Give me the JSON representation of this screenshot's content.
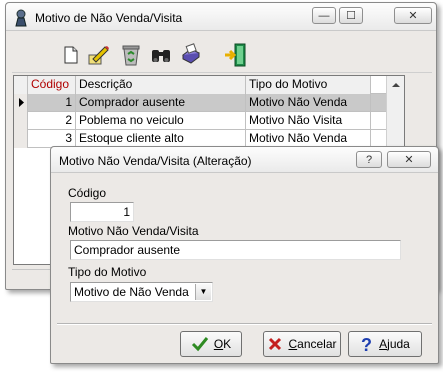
{
  "main_window": {
    "title": "Motivo de Não Venda/Visita",
    "caption_buttons": {
      "minimize": "—",
      "maximize": "☐",
      "close": "✕"
    },
    "toolbar": [
      {
        "name": "new-document-icon",
        "glyph": "🗋"
      },
      {
        "name": "edit-pencil-icon",
        "glyph": "✎"
      },
      {
        "name": "recycle-bin-icon",
        "glyph": "♻"
      },
      {
        "name": "binoculars-icon",
        "glyph": "🔭"
      },
      {
        "name": "print-icon",
        "glyph": "⎙"
      },
      {
        "name": "exit-door-icon",
        "glyph": "⇥"
      }
    ],
    "grid": {
      "columns": [
        "Código",
        "Descrição",
        "Tipo do Motivo"
      ],
      "rows": [
        {
          "codigo": "1",
          "descricao": "Comprador ausente",
          "tipo": "Motivo Não Venda",
          "selected": true
        },
        {
          "codigo": "2",
          "descricao": "Poblema no veiculo",
          "tipo": "Motivo Não Visita",
          "selected": false
        },
        {
          "codigo": "3",
          "descricao": "Estoque cliente alto",
          "tipo": "Motivo Não Venda",
          "selected": false
        }
      ]
    }
  },
  "dialog": {
    "title": "Motivo Não Venda/Visita (Alteração)",
    "caption_buttons": {
      "help": "?",
      "close": "✕"
    },
    "codigo_label": "Código",
    "codigo_value": "1",
    "motivo_label": "Motivo Não Venda/Visita",
    "motivo_value": "Comprador ausente",
    "tipo_label": "Tipo do Motivo",
    "tipo_value": "Motivo de Não Venda",
    "buttons": {
      "ok": {
        "prefix": "",
        "accel": "O",
        "rest": "K",
        "icon_color": "#2e8b22"
      },
      "cancel": {
        "prefix": "",
        "accel": "C",
        "rest": "ancelar",
        "icon_color": "#c42020"
      },
      "help": {
        "prefix": "",
        "accel": "A",
        "rest": "juda",
        "icon_color": "#1f3fb0"
      }
    }
  }
}
